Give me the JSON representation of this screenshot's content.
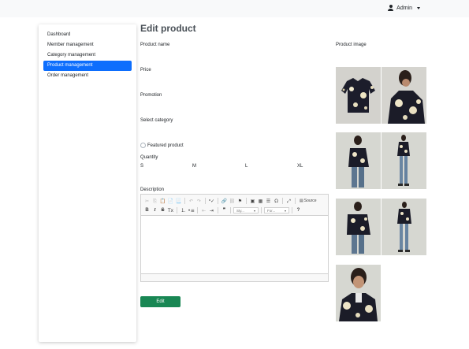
{
  "topbar": {
    "user_label": "Admin"
  },
  "sidebar": {
    "items": [
      {
        "label": "Dashboard",
        "active": false
      },
      {
        "label": "Member management",
        "active": false
      },
      {
        "label": "Category management",
        "active": false
      },
      {
        "label": "Product management",
        "active": true
      },
      {
        "label": "Order management",
        "active": false
      }
    ]
  },
  "form": {
    "title": "Edit product",
    "product_name_label": "Product name",
    "price_label": "Price",
    "promotion_label": "Promotion",
    "category_label": "Select category",
    "featured_label": "Featured product",
    "quantity_label": "Quantity",
    "sizes": [
      "S",
      "M",
      "L",
      "XL"
    ],
    "description_label": "Description",
    "submit_label": "Edit"
  },
  "editor": {
    "source_label": "Source",
    "styles_placeholder": "Sty...",
    "format_placeholder": "For..."
  },
  "images": {
    "label": "Product image",
    "count": 7
  },
  "colors": {
    "accent": "#0d6efd",
    "submit": "#198754"
  }
}
